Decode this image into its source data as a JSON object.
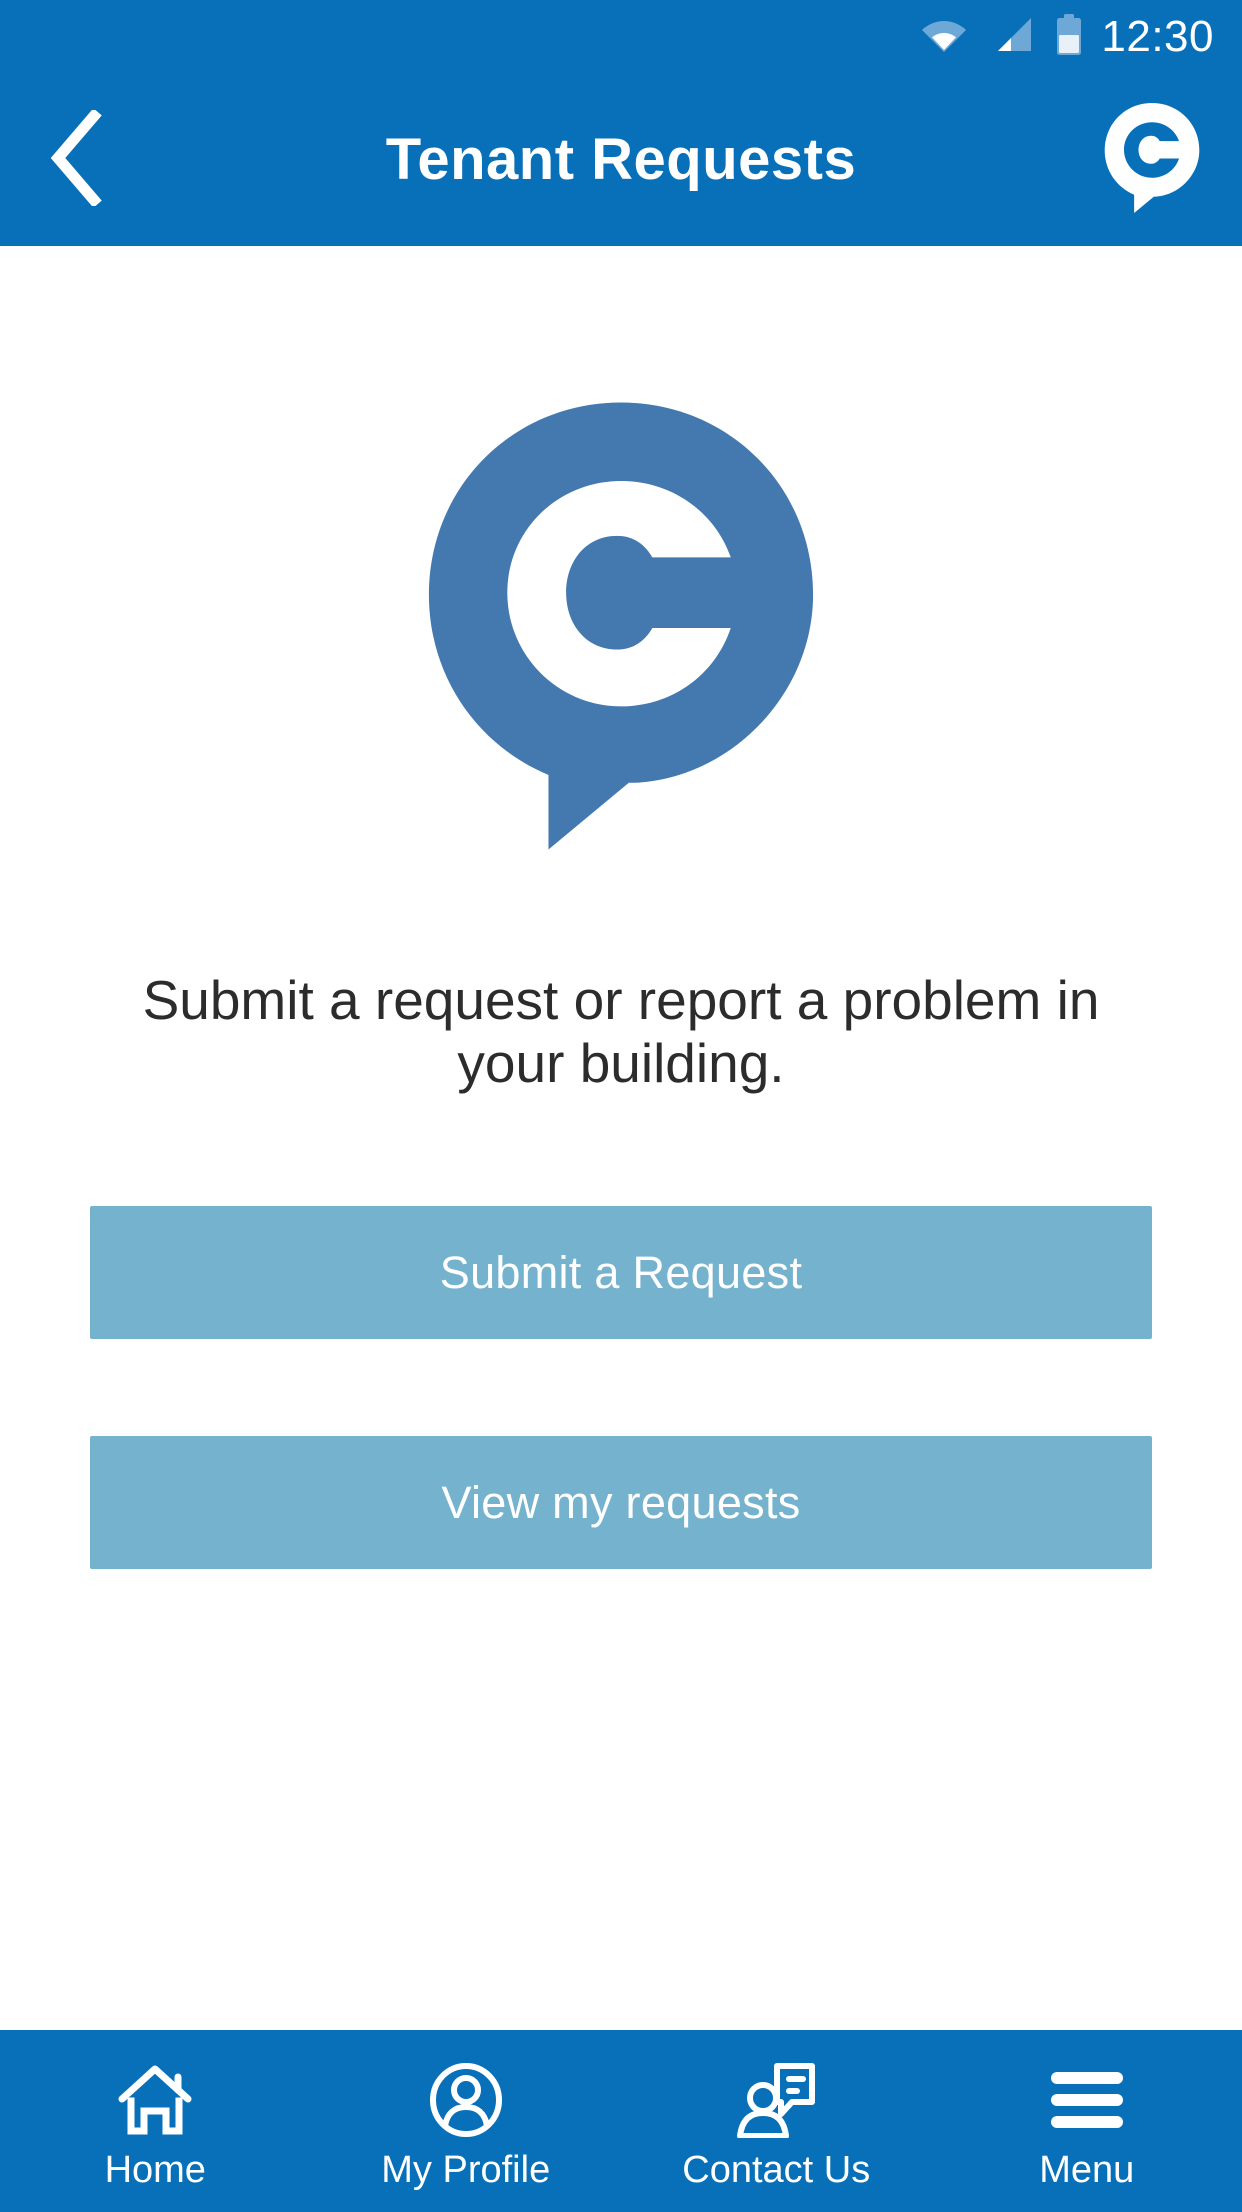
{
  "status_bar": {
    "time": "12:30",
    "icons": [
      "wifi-icon",
      "cellular-signal-icon",
      "battery-icon"
    ],
    "battery_level_pct": 45,
    "background_color": "#0770b8",
    "text_color": "#ffffff"
  },
  "header": {
    "title": "Tenant Requests",
    "back_icon": "chevron-left-icon",
    "logo_icon": "app-logo-icon",
    "background_color": "#0770b8",
    "title_color": "#ffffff"
  },
  "main": {
    "logo_icon": "app-logo-icon",
    "logo_color": "#4479b0",
    "tagline": "Submit a request or report a problem in your building.",
    "tagline_color": "#2c2c2c",
    "buttons": [
      {
        "label": "Submit a Request",
        "name": "submit-request-button",
        "color": "#74b2cd"
      },
      {
        "label": "View my requests",
        "name": "view-my-requests-button",
        "color": "#74b2cd"
      }
    ],
    "background_color": "#ffffff"
  },
  "bottom_nav": {
    "background_color": "#0770b8",
    "label_color": "#ffffff",
    "items": [
      {
        "label": "Home",
        "icon": "home-icon"
      },
      {
        "label": "My Profile",
        "icon": "user-circle-icon"
      },
      {
        "label": "Contact Us",
        "icon": "person-message-icon"
      },
      {
        "label": "Menu",
        "icon": "hamburger-menu-icon"
      }
    ]
  }
}
